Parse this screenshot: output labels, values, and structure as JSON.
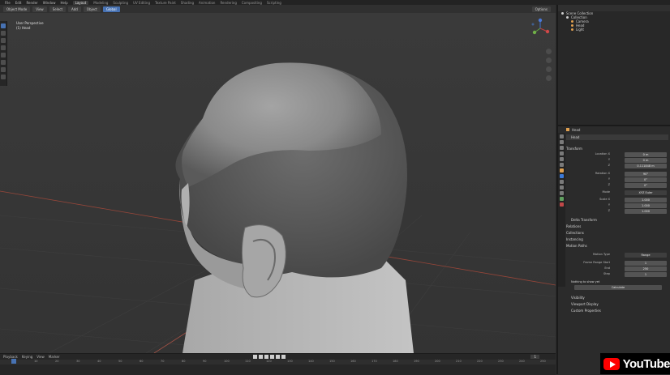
{
  "app": {
    "menus": [
      "File",
      "Edit",
      "Render",
      "Window",
      "Help"
    ],
    "workspaces": [
      "Layout",
      "Modeling",
      "Sculpting",
      "UV Editing",
      "Texture Paint",
      "Shading",
      "Animation",
      "Rendering",
      "Compositing",
      "Scripting"
    ],
    "active_workspace": "Layout"
  },
  "viewport_header": {
    "mode": "Object Mode",
    "view": "View",
    "select": "Select",
    "add": "Add",
    "object": "Object",
    "transform": "Global",
    "options": "Options"
  },
  "viewport": {
    "label_top": "User Perspective",
    "label_collection": "(1) Head"
  },
  "outliner": {
    "root": "Scene Collection",
    "items": [
      {
        "name": "Collection",
        "icon": "collection-icon",
        "color": "#cfcfcf"
      },
      {
        "name": "Camera",
        "icon": "camera-icon",
        "color": "#e0a050"
      },
      {
        "name": "Head",
        "icon": "mesh-icon",
        "color": "#e0a050"
      },
      {
        "name": "Light",
        "icon": "light-icon",
        "color": "#e0a050"
      }
    ]
  },
  "properties": {
    "object_name": "Head",
    "tab_title": "Head",
    "sections": {
      "transform": "Transform",
      "delta": "Delta Transform",
      "relations": "Relations",
      "collections": "Collections",
      "instancing": "Instancing",
      "motion_paths": "Motion Paths",
      "visibility": "Visibility",
      "viewport_display": "Viewport Display",
      "custom_props": "Custom Properties"
    },
    "location": [
      {
        "label": "Location X",
        "value": "0 m"
      },
      {
        "label": "Y",
        "value": "0 m"
      },
      {
        "label": "Z",
        "value": "0.111848 m"
      }
    ],
    "rotation": [
      {
        "label": "Rotation X",
        "value": "90°"
      },
      {
        "label": "Y",
        "value": "0°"
      },
      {
        "label": "Z",
        "value": "0°"
      }
    ],
    "mode": {
      "label": "Mode",
      "value": "XYZ Euler"
    },
    "scale": [
      {
        "label": "Scale X",
        "value": "1.000"
      },
      {
        "label": "Y",
        "value": "1.000"
      },
      {
        "label": "Z",
        "value": "1.000"
      }
    ],
    "instancing": {
      "label": "Motion Type",
      "value": "Range"
    },
    "calc": [
      {
        "label": "Frame Range Start",
        "value": "1"
      },
      {
        "label": "End",
        "value": "250"
      },
      {
        "label": "Step",
        "value": "1"
      }
    ],
    "calc_button": "Calculate",
    "nothing_to_show": "Nothing to show yet"
  },
  "timeline": {
    "labels": [
      "Playback",
      "Keying",
      "View",
      "Marker"
    ],
    "current_frame": "1",
    "ruler": [
      "0",
      "10",
      "20",
      "30",
      "40",
      "50",
      "60",
      "70",
      "80",
      "90",
      "100",
      "110",
      "120",
      "130",
      "140",
      "150",
      "160",
      "170",
      "180",
      "190",
      "200",
      "210",
      "220",
      "230",
      "240",
      "250"
    ]
  },
  "youtube": {
    "text": "YouTube"
  },
  "colors": {
    "accent": "#4772b3",
    "x_axis": "#b04a3a",
    "y_axis": "#7a8a2a",
    "youtube_red": "#ff0000"
  }
}
